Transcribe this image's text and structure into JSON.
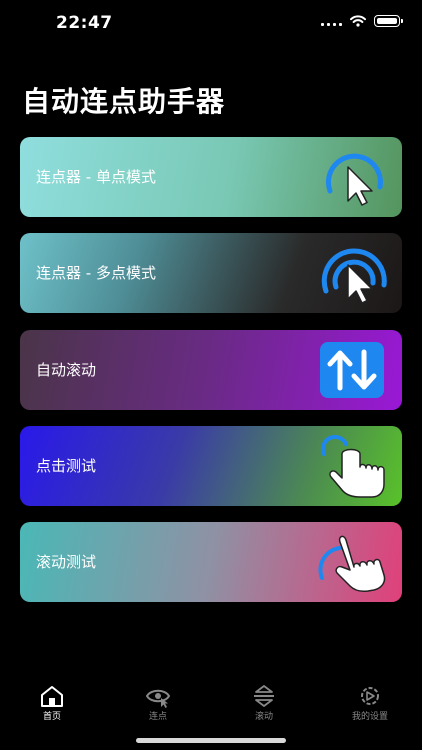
{
  "status_bar": {
    "time": "22:47"
  },
  "header": {
    "title": "自动连点助手器"
  },
  "cards": [
    {
      "label": "连点器 - 单点模式",
      "icon": "single-click-cursor-icon"
    },
    {
      "label": "连点器 - 多点模式",
      "icon": "multi-click-cursor-icon"
    },
    {
      "label": "自动滚动",
      "icon": "swap-arrows-icon"
    },
    {
      "label": "点击测试",
      "icon": "tap-hand-icon"
    },
    {
      "label": "滚动测试",
      "icon": "swipe-hand-icon"
    }
  ],
  "tabbar": {
    "items": [
      {
        "label": "首页",
        "icon": "home-icon",
        "active": true
      },
      {
        "label": "连点",
        "icon": "click-eye-icon",
        "active": false
      },
      {
        "label": "滚动",
        "icon": "scroll-icon",
        "active": false
      },
      {
        "label": "我的设置",
        "icon": "settings-icon",
        "active": false
      }
    ]
  },
  "colors": {
    "accent_blue": "#1e88f0",
    "background": "#000000"
  }
}
